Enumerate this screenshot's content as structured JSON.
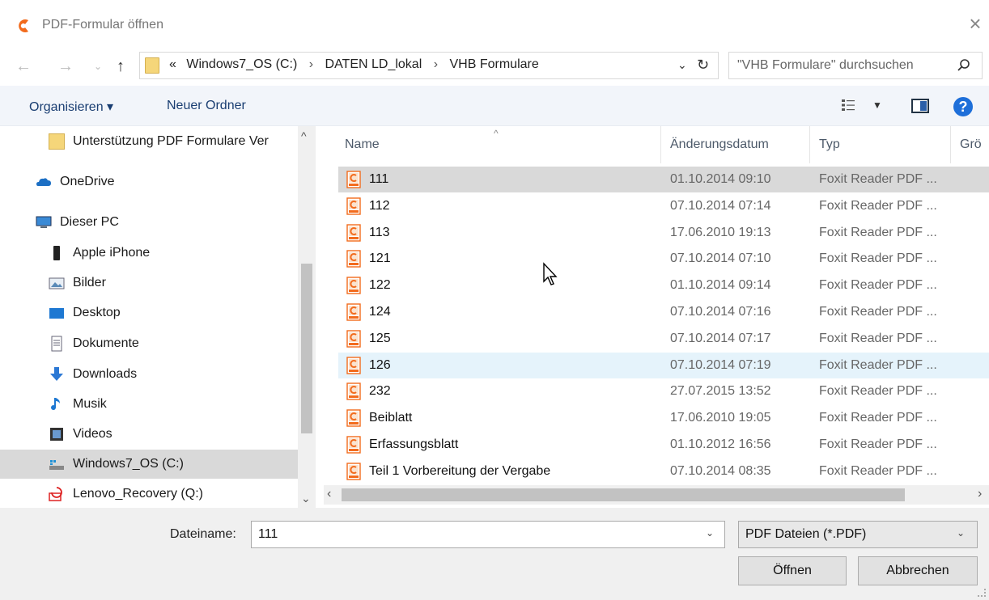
{
  "window": {
    "title": "PDF-Formular öffnen",
    "accent_color": "#f26b1d"
  },
  "address": {
    "overflow": "«",
    "crumbs": [
      "Windows7_OS (C:)",
      "DATEN LD_lokal",
      "VHB Formulare"
    ],
    "separator": "›"
  },
  "search": {
    "placeholder": "\"VHB Formulare\" durchsuchen"
  },
  "toolbar": {
    "organize": "Organisieren ▾",
    "new_folder": "Neuer Ordner"
  },
  "navpane": {
    "items": [
      {
        "label": "Unterstützung PDF Formulare  Ver",
        "icon": "folder-icon"
      },
      {
        "label": "OneDrive",
        "icon": "cloud-icon"
      },
      {
        "label": "Dieser PC",
        "icon": "computer-icon"
      },
      {
        "label": "Apple iPhone",
        "icon": "phone-icon"
      },
      {
        "label": "Bilder",
        "icon": "pictures-icon"
      },
      {
        "label": "Desktop",
        "icon": "desktop-icon"
      },
      {
        "label": "Dokumente",
        "icon": "documents-icon"
      },
      {
        "label": "Downloads",
        "icon": "downloads-icon"
      },
      {
        "label": "Musik",
        "icon": "music-icon"
      },
      {
        "label": "Videos",
        "icon": "videos-icon"
      },
      {
        "label": "Windows7_OS (C:)",
        "icon": "drive-icon"
      },
      {
        "label": "Lenovo_Recovery (Q:)",
        "icon": "recovery-drive-icon"
      }
    ]
  },
  "filelist": {
    "columns": [
      "Name",
      "Änderungsdatum",
      "Typ",
      "Grö"
    ],
    "rows": [
      {
        "name": "111",
        "date": "01.10.2014 09:10",
        "type": "Foxit Reader PDF ..."
      },
      {
        "name": "112",
        "date": "07.10.2014 07:14",
        "type": "Foxit Reader PDF ..."
      },
      {
        "name": "113",
        "date": "17.06.2010 19:13",
        "type": "Foxit Reader PDF ..."
      },
      {
        "name": "121",
        "date": "07.10.2014 07:10",
        "type": "Foxit Reader PDF ..."
      },
      {
        "name": "122",
        "date": "01.10.2014 09:14",
        "type": "Foxit Reader PDF ..."
      },
      {
        "name": "124",
        "date": "07.10.2014 07:16",
        "type": "Foxit Reader PDF ..."
      },
      {
        "name": "125",
        "date": "07.10.2014 07:17",
        "type": "Foxit Reader PDF ..."
      },
      {
        "name": "126",
        "date": "07.10.2014 07:19",
        "type": "Foxit Reader PDF ..."
      },
      {
        "name": "232",
        "date": "27.07.2015 13:52",
        "type": "Foxit Reader PDF ..."
      },
      {
        "name": "Beiblatt",
        "date": "17.06.2010 19:05",
        "type": "Foxit Reader PDF ..."
      },
      {
        "name": "Erfassungsblatt",
        "date": "01.10.2012 16:56",
        "type": "Foxit Reader PDF ..."
      },
      {
        "name": "Teil 1 Vorbereitung der Vergabe",
        "date": "07.10.2014 08:35",
        "type": "Foxit Reader PDF ..."
      }
    ]
  },
  "bottom": {
    "filename_label": "Dateiname:",
    "filename_value": "111",
    "filetype": "PDF Dateien (*.PDF)",
    "open_label": "Öffnen",
    "cancel_label": "Abbrechen"
  }
}
